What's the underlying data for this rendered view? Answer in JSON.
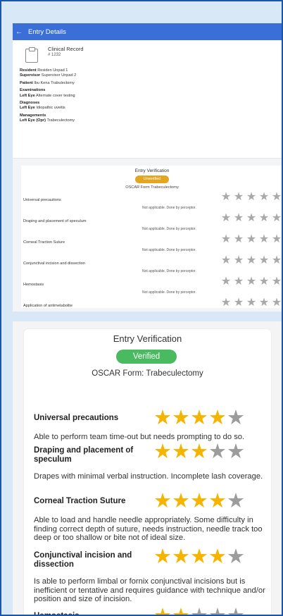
{
  "appbar": {
    "back_icon": "arrow-left-icon",
    "title": "Entry Details"
  },
  "record": {
    "title": "Clinical Record",
    "id": "# 1232",
    "resident_label": "Resident",
    "resident_value": "Residen Unpad 1",
    "supervisor_label": "Supervisor",
    "supervisor_value": "Supervisor Unpad 2",
    "patient_label": "Patient",
    "patient_value": "Ibu Kena Trabulectomy",
    "examinations_label": "Examinations",
    "exam_eye": "Left Eye",
    "exam_value": "Alternate cover testing",
    "diagnoses_label": "Diagnoses",
    "diag_eye": "Left Eye",
    "diag_value": "Idiopathic uveitis",
    "managements_label": "Managements",
    "mgmt_eye": "Left Eye (Opr)",
    "mgmt_value": "Trabeculectomy"
  },
  "verification_preview": {
    "title": "Entry Verification",
    "status": "Unverified",
    "status_color": "#e4a521",
    "form": "OSCAR Form Trabeculectomy",
    "items": [
      {
        "label": "Universal precautions",
        "note": "Not applicable. Done by perceptor.",
        "rating": 0
      },
      {
        "label": "Draping and placement of speculum",
        "note": "Not applicable. Done by perceptor.",
        "rating": 0
      },
      {
        "label": "Corneal Traction  Suture",
        "note": "Not applicable. Done by perceptor.",
        "rating": 0
      },
      {
        "label": "Conjunctival incision  and dissection",
        "note": "Not applicable. Done by perceptor.",
        "rating": 0
      },
      {
        "label": "Hemostasis",
        "note": "Not applicable. Done by perceptor.",
        "rating": 0
      },
      {
        "label": "Application of  antimetabolite",
        "note": "",
        "rating": 0
      }
    ]
  },
  "verification_detail": {
    "title": "Entry Verification",
    "status": "Verified",
    "status_color": "#4aba61",
    "form": "OSCAR Form: Trabeculectomy",
    "items": [
      {
        "label": "Universal precautions",
        "rating": 4,
        "description": "Able to perform team time-out but needs prompting to do so."
      },
      {
        "label": "Draping and placement of speculum",
        "rating": 3,
        "description": "Drapes with minimal verbal  instruction. Incomplete lash coverage."
      },
      {
        "label": "Corneal Traction  Suture",
        "rating": 4,
        "description": "Able to load and handle needle  appropriately. Some difficulty in  finding correct depth of suture, needs instruction, needle track too deep or  too shallow or bite not of ideal size."
      },
      {
        "label": "Conjunctival incision  and dissection",
        "rating": 4,
        "description": "Is able to perform limbal or fornix  conjunctival incisions but is inefficient  or tentative and requires guidance  with technique and/or position and  size of incision."
      },
      {
        "label": "Hemostasis",
        "rating": 2,
        "description": ""
      }
    ]
  },
  "colors": {
    "appbar": "#3b6fd8",
    "star_on": "#f5b400",
    "star_off": "#9c9c9c",
    "frame": "#1b55a8"
  }
}
